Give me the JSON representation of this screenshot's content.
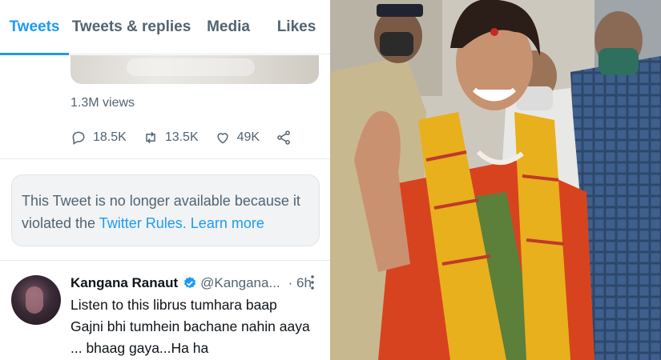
{
  "tabs": [
    {
      "label": "Tweets"
    },
    {
      "label": "Tweets & replies"
    },
    {
      "label": "Media"
    },
    {
      "label": "Likes"
    }
  ],
  "tweet_stats": {
    "views": "1.3M views",
    "replies": "18.5K",
    "retweets": "13.5K",
    "likes": "49K"
  },
  "notice": {
    "text": "This Tweet is no longer available because it violated the ",
    "link": "Twitter Rules.",
    "learn_more": "Learn more"
  },
  "tweet": {
    "name": "Kangana Ranaut",
    "handle": "@Kangana...",
    "time": "· 6h",
    "text": "Listen to this librus tumhara baap Gajni bhi tumhein bachane nahin aaya ... bhaag gaya...Ha ha"
  },
  "colors": {
    "accent": "#1d9bf0",
    "muted": "#536471",
    "scarf": "#e8b01c",
    "saree": "#d8431f"
  },
  "icons": [
    "reply-icon",
    "retweet-icon",
    "like-icon",
    "share-icon",
    "verified-icon",
    "more-icon"
  ]
}
